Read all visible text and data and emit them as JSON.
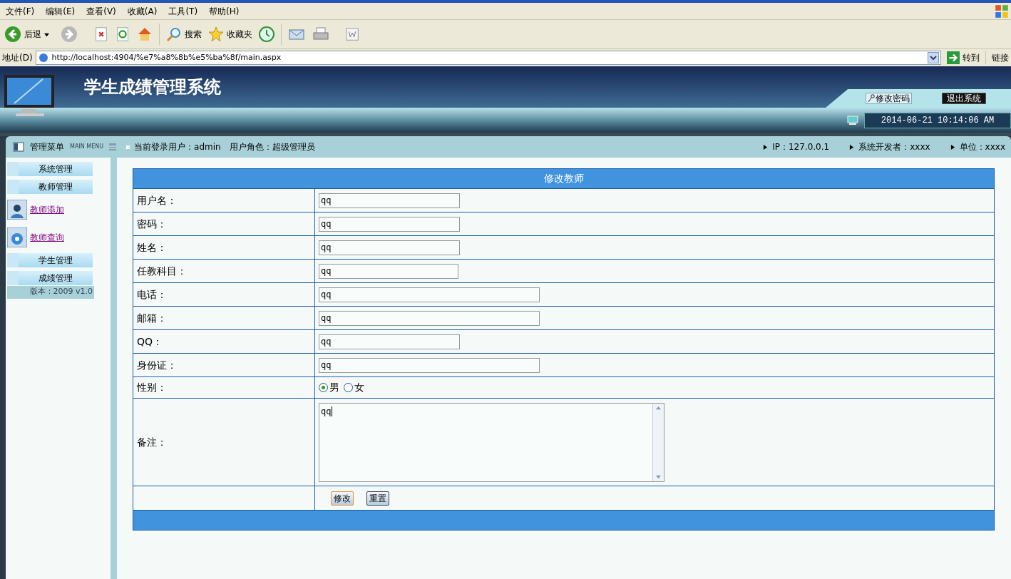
{
  "menu_bar": [
    "文件(F)",
    "编辑(E)",
    "查看(V)",
    "收藏(A)",
    "工具(T)",
    "帮助(H)"
  ],
  "toolbar": {
    "back": "后退",
    "search": "搜索",
    "favorites": "收藏夹"
  },
  "address_bar": {
    "label": "地址(D)",
    "url": "http://localhost:4904/%e7%a8%8b%e5%ba%8f/main.aspx",
    "go": "转到",
    "links": "链接"
  },
  "header": {
    "title": "学生成绩管理系统",
    "change_password": "修改密码",
    "logout": "退出系统",
    "datetime": "2014-06-21 10:14:06 AM"
  },
  "info_bar": {
    "menu_title": "管理菜单",
    "menu_subtitle": "MAIN MENU",
    "user": "当前登录用户：admin",
    "role": "用户角色：超级管理员",
    "ip": "IP：127.0.0.1",
    "developer": "系统开发者：xxxx",
    "unit": "单位：xxxx"
  },
  "sidebar": {
    "items": [
      {
        "kind": "section",
        "label": "系统管理"
      },
      {
        "kind": "section",
        "label": "教师管理"
      },
      {
        "kind": "link",
        "label": "教师添加"
      },
      {
        "kind": "link",
        "label": "教师查询"
      },
      {
        "kind": "section",
        "label": "学生管理"
      },
      {
        "kind": "section",
        "label": "成绩管理"
      }
    ],
    "version": "版本：2009 v1.0"
  },
  "form": {
    "title": "修改教师",
    "rows": [
      {
        "kind": "text",
        "label": "用户名：",
        "value": "qq"
      },
      {
        "kind": "text",
        "label": "密码：",
        "value": "qq"
      },
      {
        "kind": "text",
        "label": "姓名：",
        "value": "qq"
      },
      {
        "kind": "text",
        "label": "任教科目：",
        "value": "qq"
      },
      {
        "kind": "text",
        "label": "电话：",
        "value": "qq"
      },
      {
        "kind": "text",
        "label": "邮箱：",
        "value": "qq"
      },
      {
        "kind": "text",
        "label": "QQ：",
        "value": "qq"
      },
      {
        "kind": "text",
        "label": "身份证：",
        "value": "qq"
      },
      {
        "kind": "radio",
        "label": "性别：",
        "options": [
          {
            "label": "男",
            "selected": true
          },
          {
            "label": "女",
            "selected": false
          }
        ]
      },
      {
        "kind": "textarea",
        "label": "备注：",
        "value": "qq"
      }
    ],
    "buttons": [
      "修改",
      "重置"
    ]
  }
}
